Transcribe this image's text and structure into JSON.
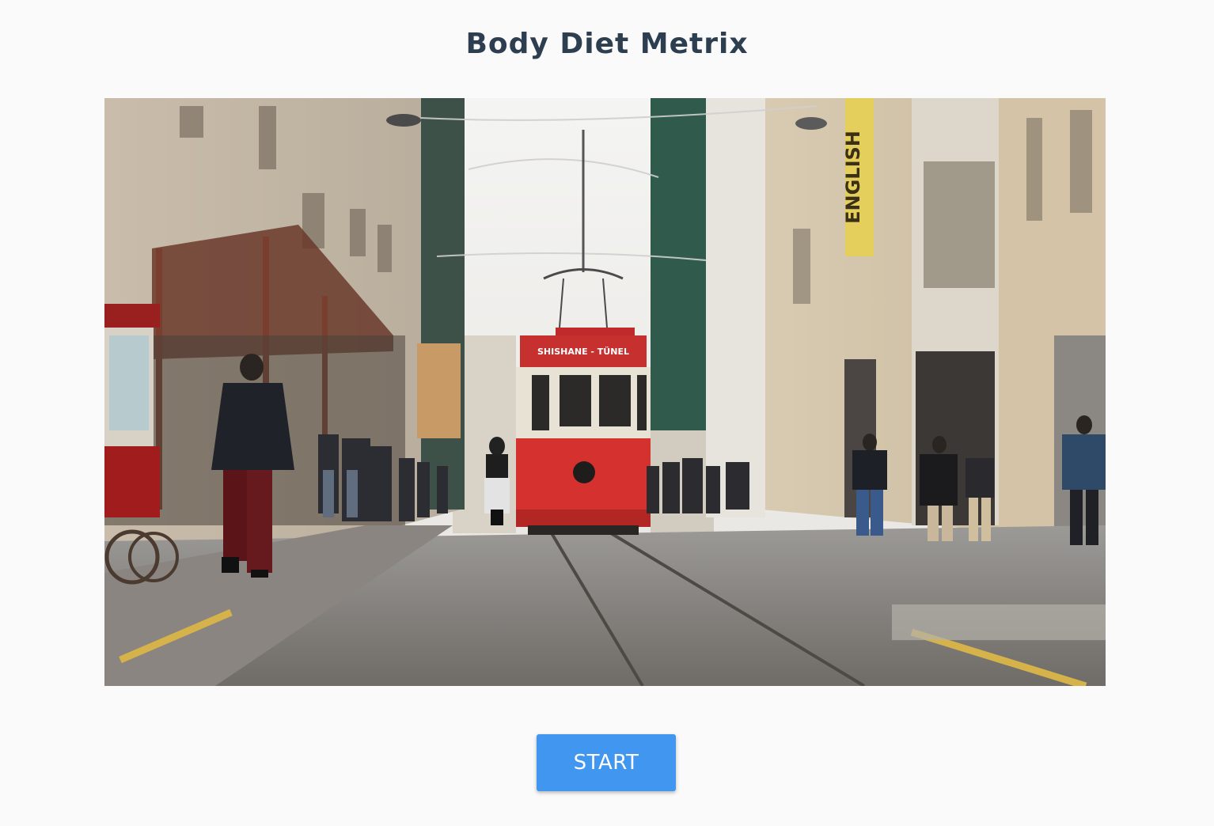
{
  "page": {
    "title": "Body Diet Metrix"
  },
  "hero": {
    "sign_text": "ENGLISH",
    "tram_label": "SHISHANE - TÜNEL"
  },
  "actions": {
    "start_label": "START"
  },
  "colors": {
    "title": "#2c3e50",
    "button": "#4196f0",
    "background": "#fafafa"
  }
}
